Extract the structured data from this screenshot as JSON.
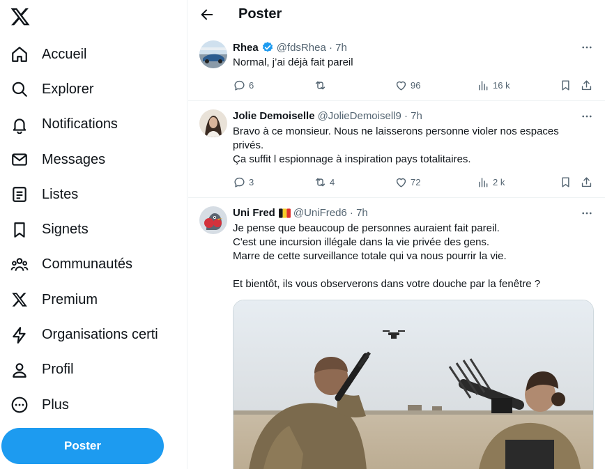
{
  "sidebar": {
    "logo_icon": "x-logo-icon",
    "items": [
      {
        "label": "Accueil",
        "icon": "home-icon"
      },
      {
        "label": "Explorer",
        "icon": "search-icon"
      },
      {
        "label": "Notifications",
        "icon": "bell-icon"
      },
      {
        "label": "Messages",
        "icon": "envelope-icon"
      },
      {
        "label": "Listes",
        "icon": "list-icon"
      },
      {
        "label": "Signets",
        "icon": "bookmark-icon"
      },
      {
        "label": "Communautés",
        "icon": "communities-icon"
      },
      {
        "label": "Premium",
        "icon": "x-logo-icon"
      },
      {
        "label": "Organisations certi",
        "icon": "lightning-icon"
      },
      {
        "label": "Profil",
        "icon": "person-icon"
      },
      {
        "label": "Plus",
        "icon": "more-circle-icon"
      }
    ],
    "post_button": "Poster"
  },
  "header": {
    "title": "Poster",
    "back_icon": "arrow-left-icon"
  },
  "tweets": [
    {
      "name": "Rhea",
      "verified": true,
      "handle": "@fdsRhea · 7h",
      "lines": [
        "Normal, j’ai déjà fait pareil"
      ],
      "replies": "6",
      "retweets": "",
      "likes": "96",
      "views": "16 k"
    },
    {
      "name": "Jolie Demoiselle",
      "verified": false,
      "handle": "@JolieDemoisell9 · 7h",
      "lines": [
        "Bravo à ce monsieur. Nous ne laisserons personne violer nos espaces",
        "privés.",
        "Ça suffit l espionnage à inspiration pays totalitaires."
      ],
      "replies": "3",
      "retweets": "4",
      "likes": "72",
      "views": "2 k"
    },
    {
      "name": "Uni Fred",
      "flag": "🇧🇪",
      "verified": false,
      "handle": "@UniFred6 · 7h",
      "lines": [
        "Je pense que beaucoup de personnes auraient fait pareil.",
        "C'est une incursion illégale dans la vie privée des gens.",
        "Marre de cette surveillance totale qui va nous pourrir la vie.",
        "",
        "Et bientôt, ils vous observerons dans votre douche par la fenêtre ?"
      ]
    }
  ],
  "colors": {
    "accent": "#1d9bf0",
    "text": "#0f1419",
    "muted": "#536471",
    "border": "#eff3f4"
  }
}
